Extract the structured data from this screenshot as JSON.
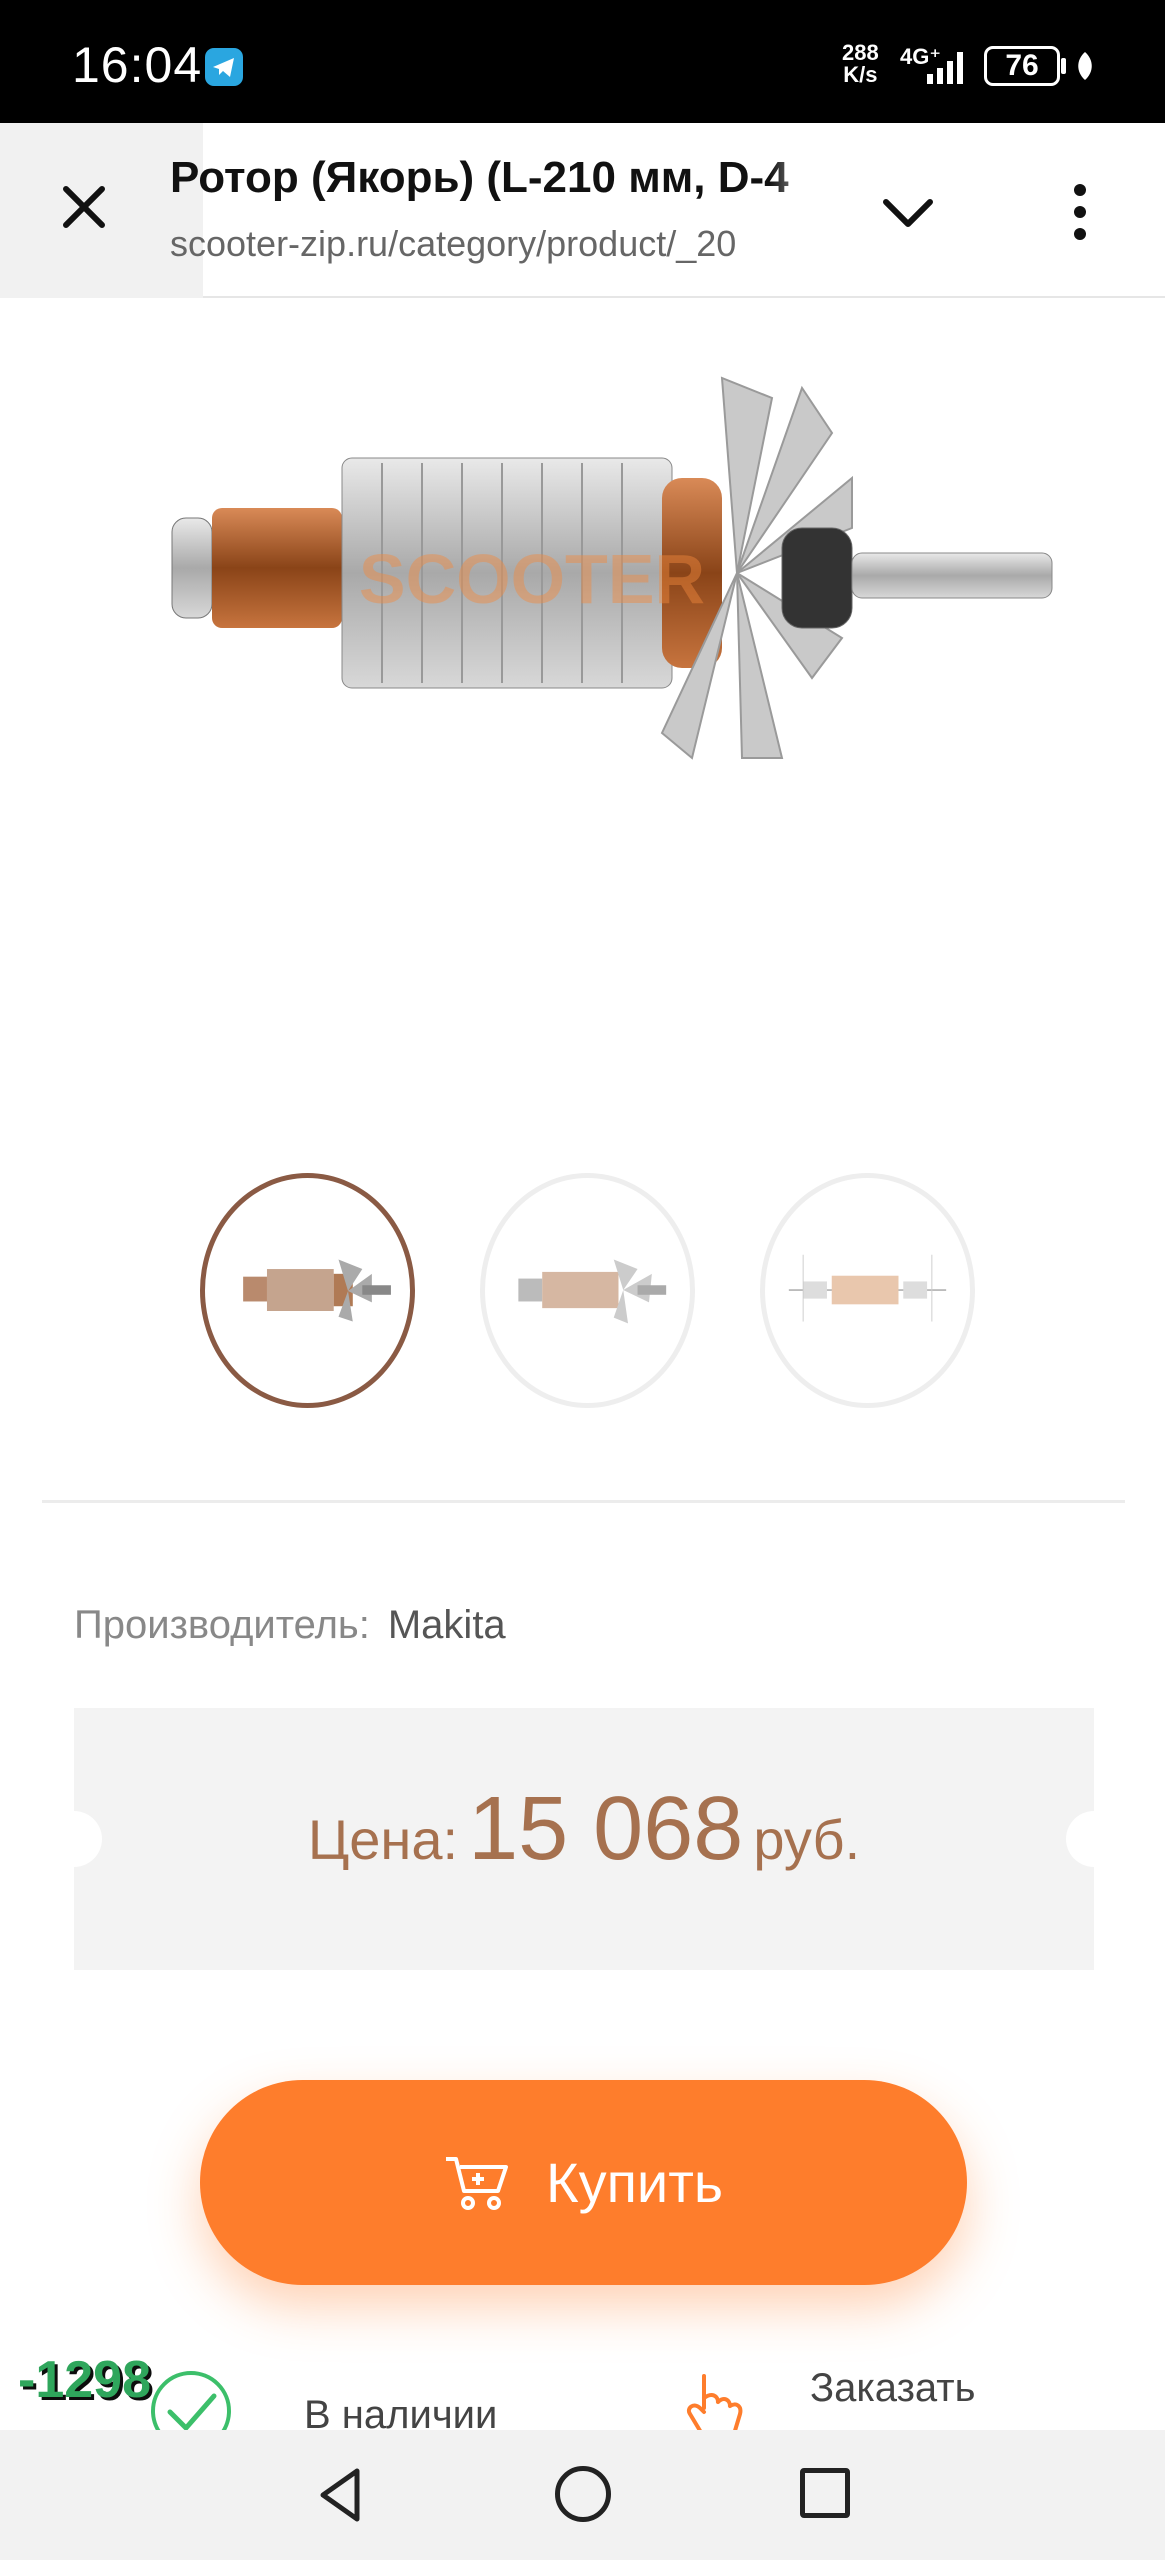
{
  "status_bar": {
    "time": "16:04",
    "net_speed_value": "288",
    "net_speed_unit": "K/s",
    "network_type": "4G⁺",
    "battery": "76",
    "icons": [
      "telegram-icon",
      "signal-icon",
      "battery-icon",
      "leaf-icon"
    ]
  },
  "app_bar": {
    "title": "Ротор (Якорь) (L-210 мм, D-4",
    "url": "scooter-zip.ru/category/product/_20",
    "icons": [
      "close-icon",
      "chevron-down-icon",
      "more-vert-icon"
    ]
  },
  "product": {
    "watermark": "SCOOTER",
    "thumbnails": [
      {
        "label": "armature-photo-1",
        "active": true
      },
      {
        "label": "armature-photo-2",
        "active": false
      },
      {
        "label": "armature-drawing",
        "active": false
      }
    ],
    "manufacturer_label": "Производитель:",
    "manufacturer_value": "Makita",
    "price_label": "Цена:",
    "price_value": "15 068",
    "price_currency": "руб.",
    "buy_label": "Купить",
    "stock_text": "В наличии",
    "order_text": "Заказать",
    "discount_badge": "-1298"
  },
  "colors": {
    "accent": "#fe7d2c",
    "price_text": "#a6714f",
    "thumb_active_border": "#8a5a44",
    "stock_green": "#2fa65c"
  }
}
